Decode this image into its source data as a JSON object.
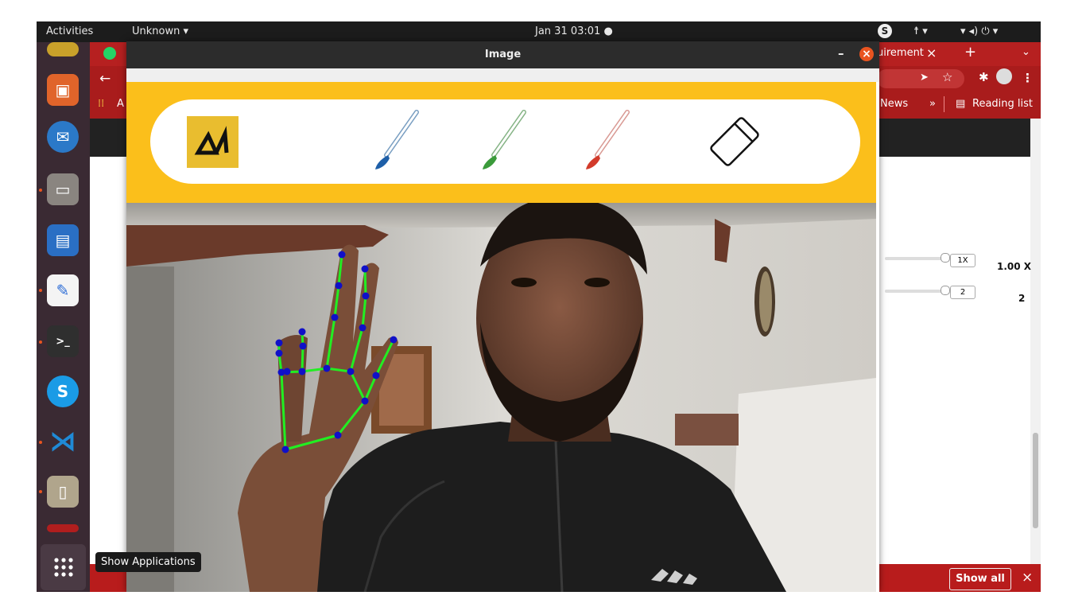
{
  "topbar": {
    "activities": "Activities",
    "app_menu": "Unknown ▾",
    "clock": "Jan 31  03:01  ●"
  },
  "browser": {
    "tab_partial": "uirement",
    "tab_close": "×",
    "new_tab": "+",
    "bookmark_news": "News",
    "bookmark_more": "»",
    "reading_list": "Reading list",
    "bookmark_a": "A",
    "speed_box": "1X",
    "speed_value": "1.00 X",
    "count_box": "2",
    "count_value": "2",
    "show_all": "Show all",
    "download_close": "×"
  },
  "window": {
    "title": "Image",
    "minimize": "–",
    "close": "×"
  },
  "tooltip": "Show Applications",
  "colors": {
    "toolbar_band": "#fbbf1b",
    "blue_brush": "#1e5fa8",
    "green_brush": "#3b9b3b",
    "red_brush": "#d23b2b",
    "landmark": "#1010c8",
    "connection": "#22ee22"
  },
  "tools": [
    "logo-icon",
    "blue-brush-icon",
    "green-brush-icon",
    "red-brush-icon",
    "eraser-icon"
  ],
  "logo": "ΔΛ"
}
